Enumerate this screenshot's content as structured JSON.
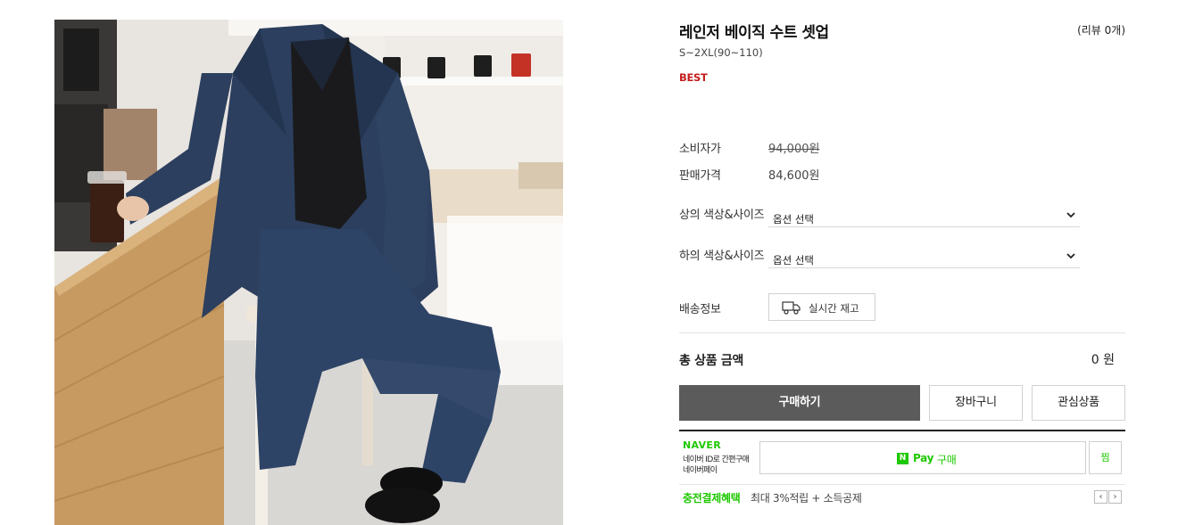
{
  "product": {
    "title": "레인저 베이직 수트 셋업",
    "review_count": "(리뷰 0개)",
    "size_range": "S~2XL(90~110)",
    "badge": "BEST",
    "image_alt": "navy suit setup model photo"
  },
  "pricing": {
    "consumer_label": "소비자가",
    "consumer_price": "94,000원",
    "sale_label": "판매가격",
    "sale_price": "84,600원"
  },
  "options": {
    "top_label": "상의 색상&사이즈",
    "top_selected": "옵션 선택",
    "bottom_label": "하의 색상&사이즈",
    "bottom_selected": "옵션 선택"
  },
  "shipping": {
    "label": "배송정보",
    "stock_button": "실시간 재고",
    "icon": "truck-icon"
  },
  "total": {
    "label": "총 상품 금액",
    "value": "0 원"
  },
  "actions": {
    "buy": "구매하기",
    "cart": "장바구니",
    "wish": "관심상품"
  },
  "npay": {
    "logo": "NAVER",
    "desc_line1": "네이버 ID로 간편구매",
    "desc_line2": "네이버페이",
    "n_mark": "N",
    "pay_label": "Pay",
    "buy_label": "구매",
    "jjim": "찜",
    "benefit_title": "충전결제혜택",
    "benefit_text": "최대 3%적립 + 소득공제",
    "prev": "‹",
    "next": "›"
  },
  "colors": {
    "best_red": "#c41e1e",
    "naver_green": "#1ec800",
    "buy_button": "#5b5b5b"
  }
}
